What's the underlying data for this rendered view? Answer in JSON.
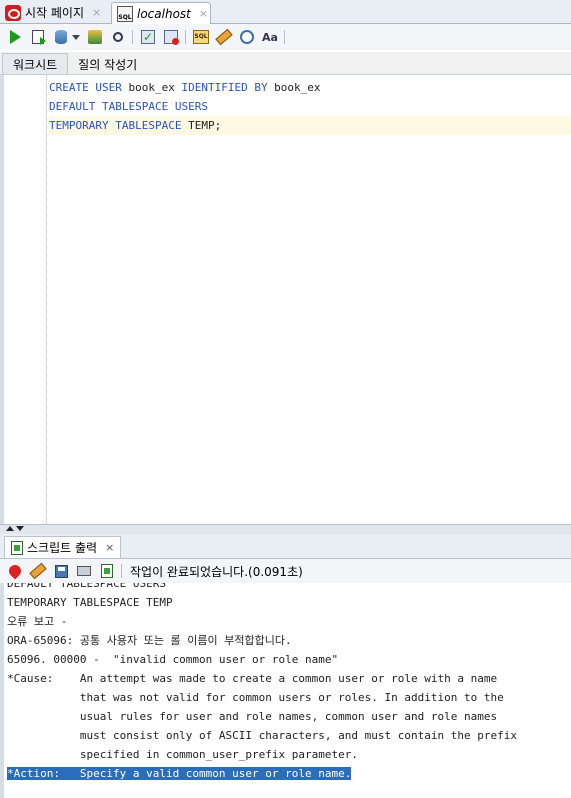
{
  "doc_tabs": [
    {
      "label": "시작 페이지",
      "icon": "oracle-icon",
      "close": "×"
    },
    {
      "label": "localhost",
      "icon": "sql-connection-icon",
      "icon_text": "SQL",
      "close": "×"
    }
  ],
  "toolbar": {
    "icons": [
      "run-statement-icon",
      "run-script-icon",
      "commit-icon",
      "dropdown-caret-icon",
      "debug-icon",
      "explain-plan-icon",
      "commit-check-icon",
      "rollback-icon",
      "sql-tuning-icon",
      "clear-icon",
      "history-icon",
      "format-icon"
    ],
    "format_label": "Aa"
  },
  "subtabs": [
    "워크시트",
    "질의 작성기"
  ],
  "editor": {
    "lines": [
      [
        {
          "t": "CREATE USER",
          "kw": true
        },
        {
          "t": " book_ex ",
          "kw": false
        },
        {
          "t": "IDENTIFIED BY",
          "kw": true
        },
        {
          "t": " book_ex",
          "kw": false
        }
      ],
      [
        {
          "t": "DEFAULT TABLESPACE USERS",
          "kw": true
        }
      ],
      [
        {
          "t": "TEMPORARY TABLESPACE",
          "kw": true
        },
        {
          "t": " TEMP;",
          "kw": false
        }
      ]
    ]
  },
  "output_panel": {
    "tab_label": "스크립트 출력",
    "close": "×",
    "status": "작업이 완료되었습니다.(0.091초)",
    "lines": [
      "DEFAULT TABLESPACE USERS",
      "TEMPORARY TABLESPACE TEMP",
      "오류 보고 -",
      "ORA-65096: 공통 사용자 또는 롤 이름이 부적합합니다.",
      "65096. 00000 -  \"invalid common user or role name\"",
      "*Cause:    An attempt was made to create a common user or role with a name",
      "           that was not valid for common users or roles. In addition to the",
      "           usual rules for user and role names, common user and role names",
      "           must consist only of ASCII characters, and must contain the prefix",
      "           specified in common_user_prefix parameter.",
      "*Action:   Specify a valid common user or role name."
    ],
    "selected_line": 10
  },
  "colors": {
    "keyword": "#2a52c4",
    "selection": "#2a6ebb",
    "current_line": "#fdf9e2"
  }
}
